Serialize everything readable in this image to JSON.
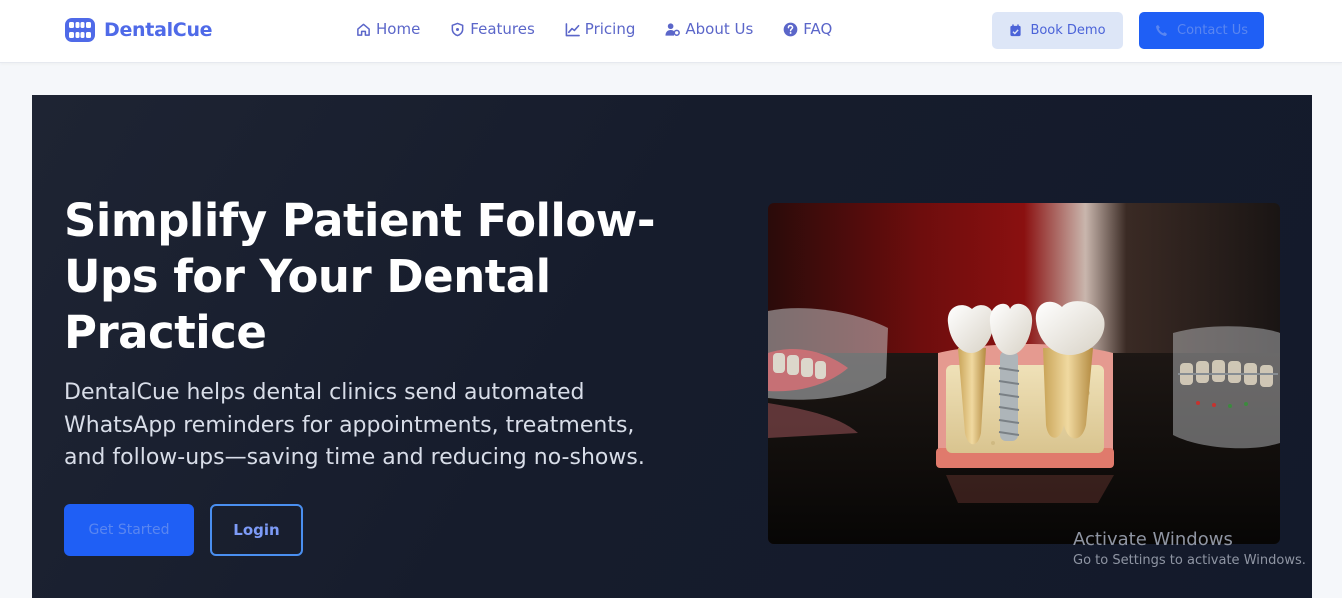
{
  "brand": {
    "name": "DentalCue",
    "icon": "dental-logo-icon"
  },
  "nav": {
    "items": [
      {
        "label": "Home",
        "icon": "home-icon"
      },
      {
        "label": "Features",
        "icon": "shield-icon"
      },
      {
        "label": "Pricing",
        "icon": "chart-line-icon"
      },
      {
        "label": "About Us",
        "icon": "user-gear-icon"
      },
      {
        "label": "FAQ",
        "icon": "question-circle-icon"
      }
    ]
  },
  "header_actions": {
    "book_demo": {
      "label": "Book Demo",
      "icon": "calendar-check-icon"
    },
    "contact": {
      "label": "Contact Us",
      "icon": "phone-icon"
    }
  },
  "hero": {
    "title": "Simplify Patient Follow-Ups for Your Dental Practice",
    "subtitle": "DentalCue helps dental clinics send automated WhatsApp reminders for appointments, treatments, and follow-ups—saving time and reducing no-shows.",
    "primary_cta": "Get Started",
    "secondary_cta": "Login"
  },
  "os_watermark": {
    "title": "Activate Windows",
    "subtitle": "Go to Settings to activate Windows."
  },
  "colors": {
    "accent": "#4f6ae8",
    "primary_button": "#1f5ff5",
    "demo_button_bg": "#dde6f7",
    "hero_bg": "#161c2c",
    "login_border": "#4a8ff0"
  }
}
